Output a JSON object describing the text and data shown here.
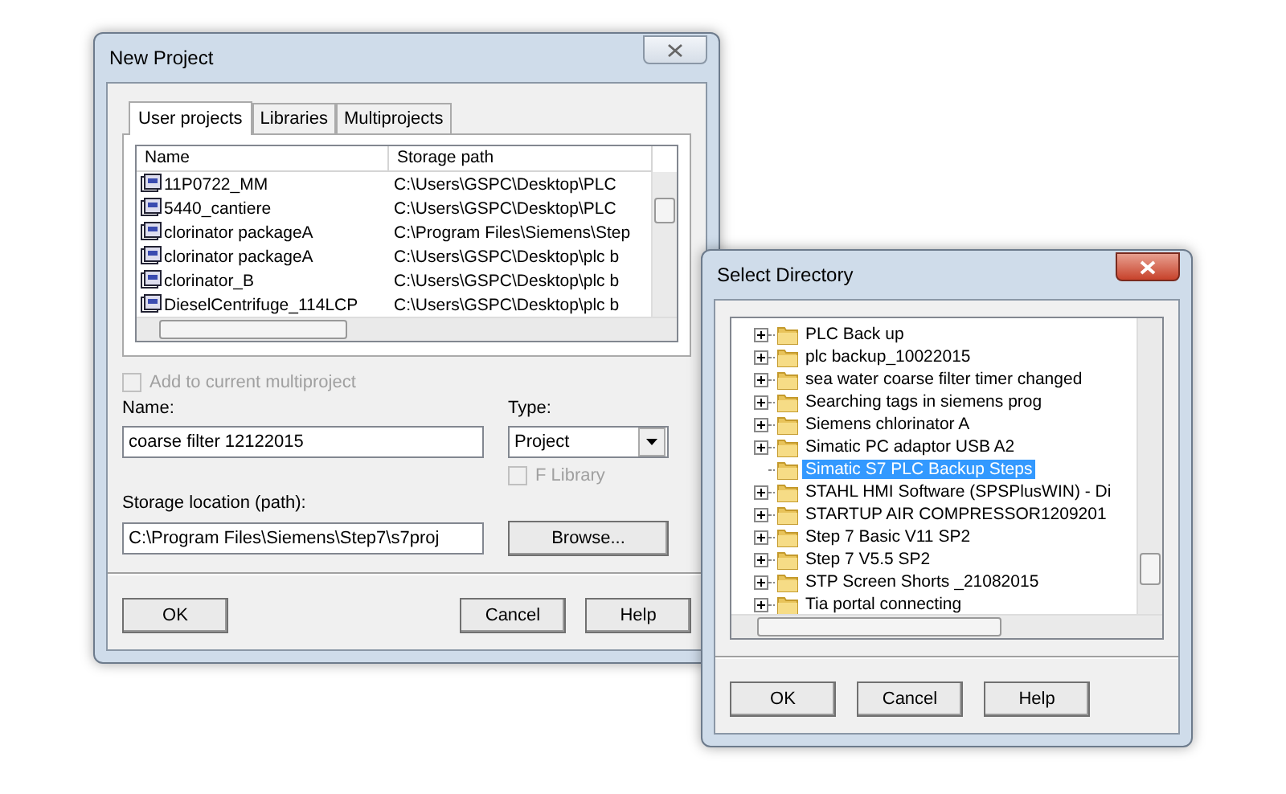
{
  "new_project": {
    "title": "New Project",
    "tabs": [
      {
        "label": "User projects",
        "selected": true
      },
      {
        "label": "Libraries",
        "selected": false
      },
      {
        "label": "Multiprojects",
        "selected": false
      }
    ],
    "columns": [
      "Name",
      "Storage path"
    ],
    "rows": [
      {
        "name": "11P0722_MM",
        "path": "C:\\Users\\GSPC\\Desktop\\PLC"
      },
      {
        "name": "5440_cantiere",
        "path": "C:\\Users\\GSPC\\Desktop\\PLC"
      },
      {
        "name": "clorinator packageA",
        "path": "C:\\Program Files\\Siemens\\Step"
      },
      {
        "name": "clorinator packageA",
        "path": "C:\\Users\\GSPC\\Desktop\\plc b"
      },
      {
        "name": "clorinator_B",
        "path": "C:\\Users\\GSPC\\Desktop\\plc b"
      },
      {
        "name": "DieselCentrifuge_114LCP",
        "path": "C:\\Users\\GSPC\\Desktop\\plc b"
      }
    ],
    "add_multiproject": {
      "label": "Add to current multiproject",
      "checked": false,
      "disabled": true
    },
    "name_label": "Name:",
    "name_value": "coarse filter 12122015",
    "type_label": "Type:",
    "type_value": "Project",
    "f_library": {
      "label": "F Library",
      "checked": false,
      "disabled": true
    },
    "location_label": "Storage location (path):",
    "location_value": "C:\\Program Files\\Siemens\\Step7\\s7proj",
    "browse": "Browse...",
    "buttons": [
      "OK",
      "Cancel",
      "Help"
    ]
  },
  "select_directory": {
    "title": "Select Directory",
    "items": [
      {
        "label": "PLC Back up",
        "expandable": true,
        "selected": false
      },
      {
        "label": "plc backup_10022015",
        "expandable": true,
        "selected": false
      },
      {
        "label": "sea water coarse filter timer changed",
        "expandable": true,
        "selected": false
      },
      {
        "label": "Searching tags in siemens prog",
        "expandable": true,
        "selected": false
      },
      {
        "label": "Siemens chlorinator A",
        "expandable": true,
        "selected": false
      },
      {
        "label": "Simatic PC adaptor USB A2",
        "expandable": true,
        "selected": false
      },
      {
        "label": "Simatic S7 PLC Backup Steps",
        "expandable": false,
        "selected": true
      },
      {
        "label": "STAHL HMI Software (SPSPlusWIN) - Di",
        "expandable": true,
        "selected": false
      },
      {
        "label": "STARTUP AIR COMPRESSOR1209201",
        "expandable": true,
        "selected": false
      },
      {
        "label": "Step 7 Basic V11 SP2",
        "expandable": true,
        "selected": false
      },
      {
        "label": "Step 7 V5.5 SP2",
        "expandable": true,
        "selected": false
      },
      {
        "label": "STP Screen Shorts _21082015",
        "expandable": true,
        "selected": false
      },
      {
        "label": "Tia portal connecting",
        "expandable": true,
        "selected": false
      }
    ],
    "buttons": [
      "OK",
      "Cancel",
      "Help"
    ]
  }
}
